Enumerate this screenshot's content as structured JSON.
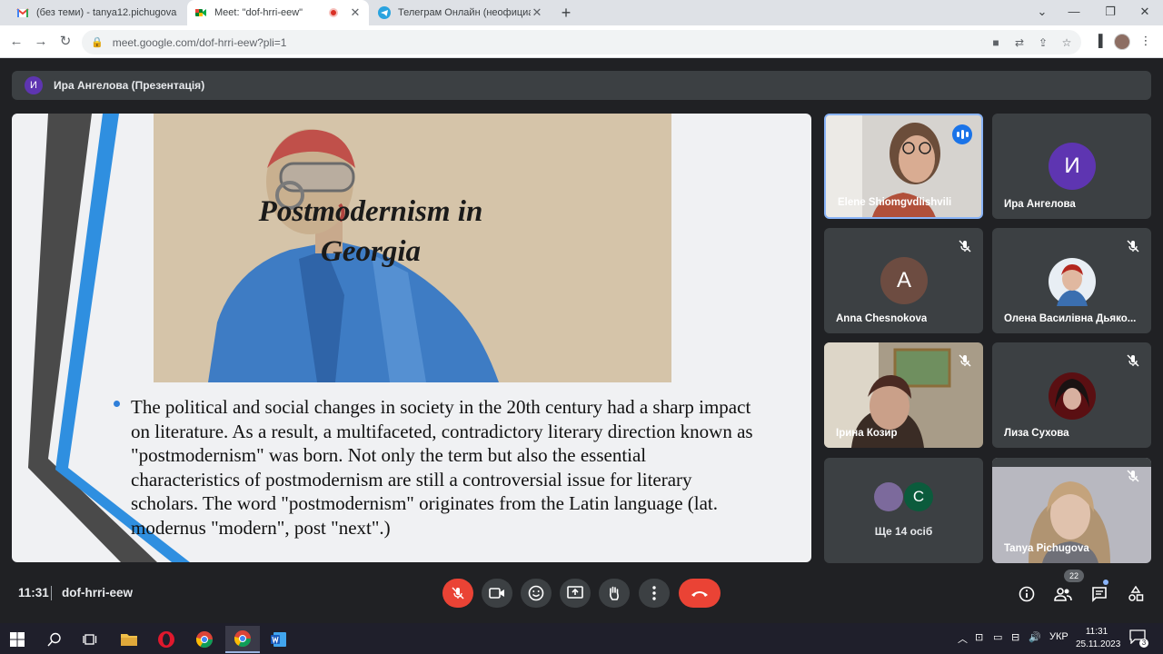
{
  "browser": {
    "tabs": [
      {
        "title": "(без теми) - tanya12.pichugova",
        "favicon": "gmail-icon"
      },
      {
        "title": "Meet: \"dof-hrri-eew\"",
        "favicon": "meet-icon",
        "active": true,
        "recording": true
      },
      {
        "title": "Телеграм Онлайн (неофициал",
        "favicon": "telegram-icon"
      }
    ],
    "url": "meet.google.com/dof-hrri-eew?pli=1"
  },
  "meet": {
    "presenter": {
      "initial": "И",
      "label": "Ира Ангелова (Презентація)"
    },
    "slide": {
      "title_line1": "Postmodernism in",
      "title_line2": "Georgia",
      "body": "The political and social changes in society in the 20th century had a sharp impact on literature. As a result, a multifaceted, contradictory literary direction known as \"postmodernism\" was born. Not only the term but also the essential characteristics of postmodernism are still a controversial issue for literary scholars. The word \"postmodernism\" originates from the Latin language (lat. modernus \"modern\", post \"next\".)"
    },
    "participants": [
      {
        "name": "Elene Shiomgvdlishvili",
        "type": "video",
        "speaking": true
      },
      {
        "name": "Ира Ангелова",
        "type": "avatar",
        "initial": "И",
        "color": "#5e35b1"
      },
      {
        "name": "Anna Chesnokova",
        "type": "avatar",
        "initial": "A",
        "color": "#6d4c41",
        "muted": true
      },
      {
        "name": "Олена Василівна Дьяко...",
        "type": "photo",
        "muted": true
      },
      {
        "name": "Ірина Козир",
        "type": "video",
        "muted": true
      },
      {
        "name": "Лиза Сухова",
        "type": "photo",
        "muted": true
      },
      {
        "name": "Tanya Pichugova",
        "type": "video",
        "muted": true
      }
    ],
    "others": {
      "initial": "C",
      "label": "Ще 14 осіб"
    },
    "bottom": {
      "time": "11:31",
      "code": "dof-hrri-eew",
      "people_count": "22"
    }
  },
  "taskbar": {
    "language": "УКР",
    "time": "11:31",
    "date": "25.11.2023",
    "notifications": "3"
  }
}
